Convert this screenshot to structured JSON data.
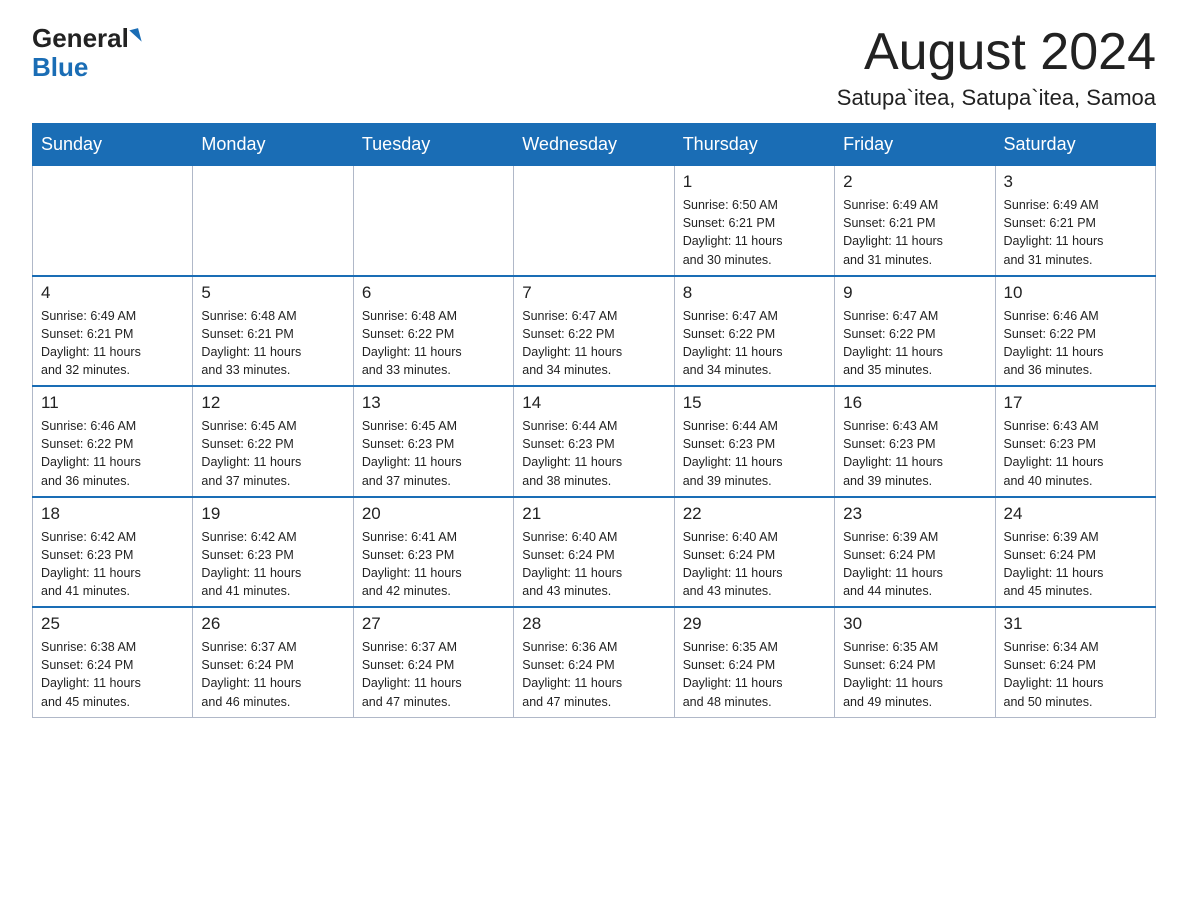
{
  "logo": {
    "general": "General",
    "blue": "Blue"
  },
  "header": {
    "month": "August 2024",
    "location": "Satupa`itea, Satupa`itea, Samoa"
  },
  "weekdays": [
    "Sunday",
    "Monday",
    "Tuesday",
    "Wednesday",
    "Thursday",
    "Friday",
    "Saturday"
  ],
  "weeks": [
    [
      {
        "day": "",
        "info": ""
      },
      {
        "day": "",
        "info": ""
      },
      {
        "day": "",
        "info": ""
      },
      {
        "day": "",
        "info": ""
      },
      {
        "day": "1",
        "info": "Sunrise: 6:50 AM\nSunset: 6:21 PM\nDaylight: 11 hours\nand 30 minutes."
      },
      {
        "day": "2",
        "info": "Sunrise: 6:49 AM\nSunset: 6:21 PM\nDaylight: 11 hours\nand 31 minutes."
      },
      {
        "day": "3",
        "info": "Sunrise: 6:49 AM\nSunset: 6:21 PM\nDaylight: 11 hours\nand 31 minutes."
      }
    ],
    [
      {
        "day": "4",
        "info": "Sunrise: 6:49 AM\nSunset: 6:21 PM\nDaylight: 11 hours\nand 32 minutes."
      },
      {
        "day": "5",
        "info": "Sunrise: 6:48 AM\nSunset: 6:21 PM\nDaylight: 11 hours\nand 33 minutes."
      },
      {
        "day": "6",
        "info": "Sunrise: 6:48 AM\nSunset: 6:22 PM\nDaylight: 11 hours\nand 33 minutes."
      },
      {
        "day": "7",
        "info": "Sunrise: 6:47 AM\nSunset: 6:22 PM\nDaylight: 11 hours\nand 34 minutes."
      },
      {
        "day": "8",
        "info": "Sunrise: 6:47 AM\nSunset: 6:22 PM\nDaylight: 11 hours\nand 34 minutes."
      },
      {
        "day": "9",
        "info": "Sunrise: 6:47 AM\nSunset: 6:22 PM\nDaylight: 11 hours\nand 35 minutes."
      },
      {
        "day": "10",
        "info": "Sunrise: 6:46 AM\nSunset: 6:22 PM\nDaylight: 11 hours\nand 36 minutes."
      }
    ],
    [
      {
        "day": "11",
        "info": "Sunrise: 6:46 AM\nSunset: 6:22 PM\nDaylight: 11 hours\nand 36 minutes."
      },
      {
        "day": "12",
        "info": "Sunrise: 6:45 AM\nSunset: 6:22 PM\nDaylight: 11 hours\nand 37 minutes."
      },
      {
        "day": "13",
        "info": "Sunrise: 6:45 AM\nSunset: 6:23 PM\nDaylight: 11 hours\nand 37 minutes."
      },
      {
        "day": "14",
        "info": "Sunrise: 6:44 AM\nSunset: 6:23 PM\nDaylight: 11 hours\nand 38 minutes."
      },
      {
        "day": "15",
        "info": "Sunrise: 6:44 AM\nSunset: 6:23 PM\nDaylight: 11 hours\nand 39 minutes."
      },
      {
        "day": "16",
        "info": "Sunrise: 6:43 AM\nSunset: 6:23 PM\nDaylight: 11 hours\nand 39 minutes."
      },
      {
        "day": "17",
        "info": "Sunrise: 6:43 AM\nSunset: 6:23 PM\nDaylight: 11 hours\nand 40 minutes."
      }
    ],
    [
      {
        "day": "18",
        "info": "Sunrise: 6:42 AM\nSunset: 6:23 PM\nDaylight: 11 hours\nand 41 minutes."
      },
      {
        "day": "19",
        "info": "Sunrise: 6:42 AM\nSunset: 6:23 PM\nDaylight: 11 hours\nand 41 minutes."
      },
      {
        "day": "20",
        "info": "Sunrise: 6:41 AM\nSunset: 6:23 PM\nDaylight: 11 hours\nand 42 minutes."
      },
      {
        "day": "21",
        "info": "Sunrise: 6:40 AM\nSunset: 6:24 PM\nDaylight: 11 hours\nand 43 minutes."
      },
      {
        "day": "22",
        "info": "Sunrise: 6:40 AM\nSunset: 6:24 PM\nDaylight: 11 hours\nand 43 minutes."
      },
      {
        "day": "23",
        "info": "Sunrise: 6:39 AM\nSunset: 6:24 PM\nDaylight: 11 hours\nand 44 minutes."
      },
      {
        "day": "24",
        "info": "Sunrise: 6:39 AM\nSunset: 6:24 PM\nDaylight: 11 hours\nand 45 minutes."
      }
    ],
    [
      {
        "day": "25",
        "info": "Sunrise: 6:38 AM\nSunset: 6:24 PM\nDaylight: 11 hours\nand 45 minutes."
      },
      {
        "day": "26",
        "info": "Sunrise: 6:37 AM\nSunset: 6:24 PM\nDaylight: 11 hours\nand 46 minutes."
      },
      {
        "day": "27",
        "info": "Sunrise: 6:37 AM\nSunset: 6:24 PM\nDaylight: 11 hours\nand 47 minutes."
      },
      {
        "day": "28",
        "info": "Sunrise: 6:36 AM\nSunset: 6:24 PM\nDaylight: 11 hours\nand 47 minutes."
      },
      {
        "day": "29",
        "info": "Sunrise: 6:35 AM\nSunset: 6:24 PM\nDaylight: 11 hours\nand 48 minutes."
      },
      {
        "day": "30",
        "info": "Sunrise: 6:35 AM\nSunset: 6:24 PM\nDaylight: 11 hours\nand 49 minutes."
      },
      {
        "day": "31",
        "info": "Sunrise: 6:34 AM\nSunset: 6:24 PM\nDaylight: 11 hours\nand 50 minutes."
      }
    ]
  ]
}
